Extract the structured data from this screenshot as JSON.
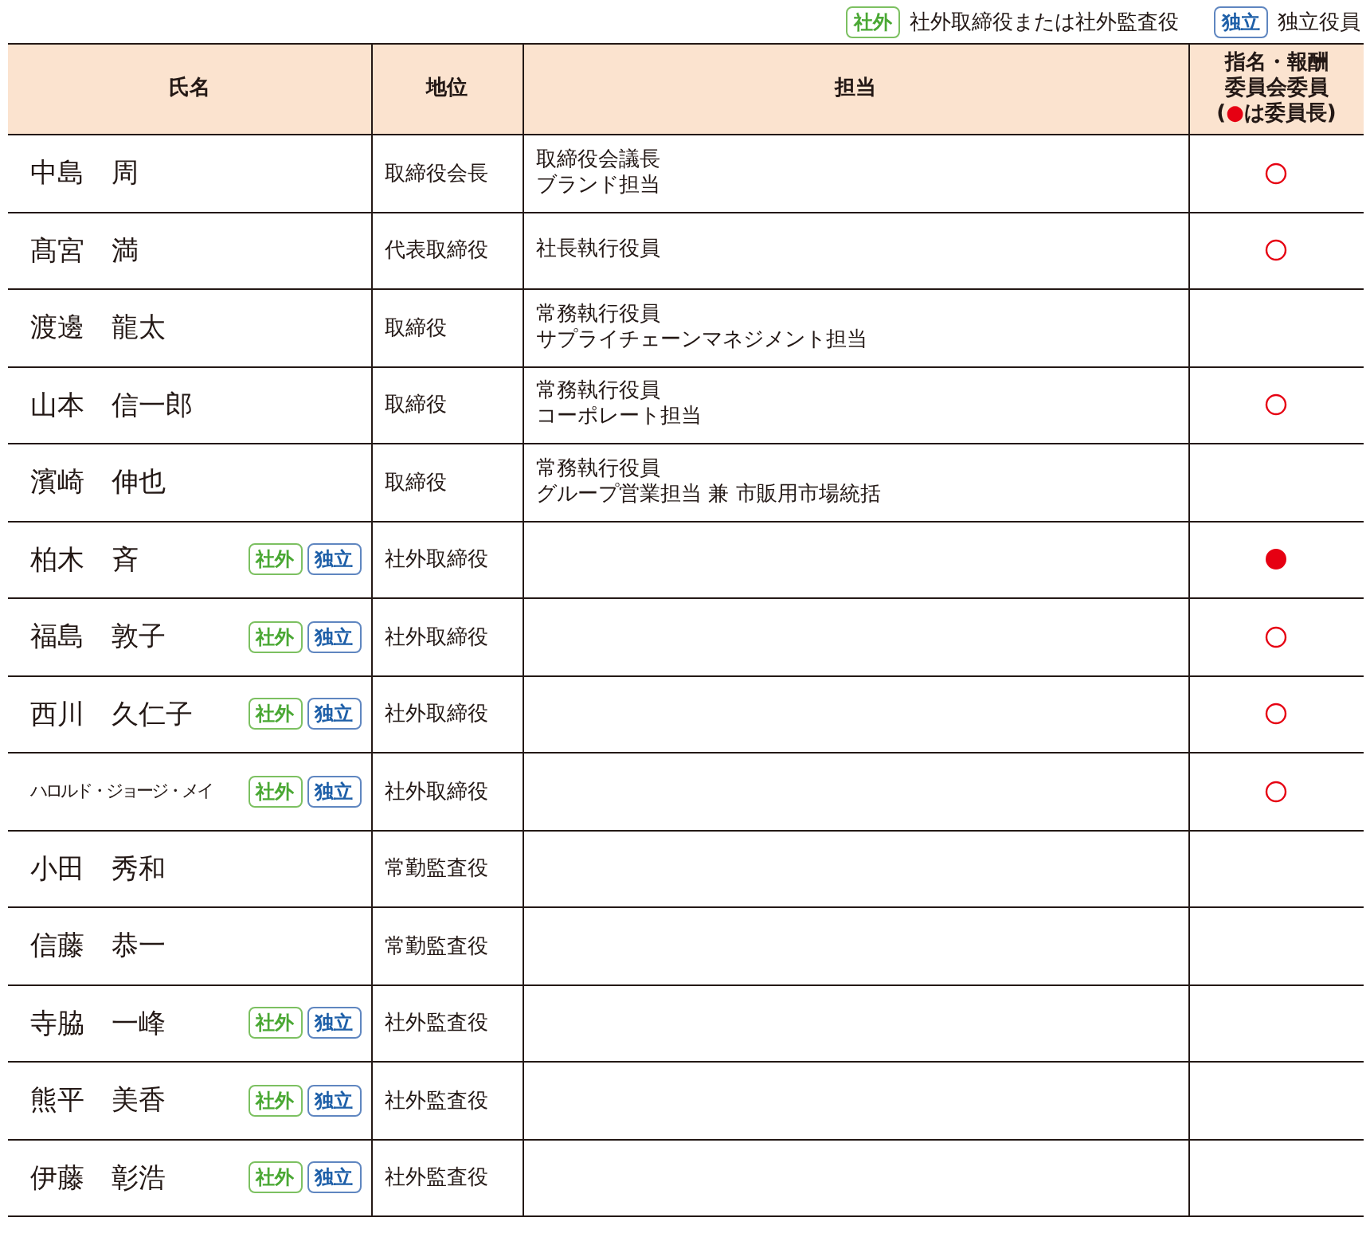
{
  "legend": [
    {
      "kind": "outside",
      "badge": "社外",
      "text": "社外取締役または社外監査役"
    },
    {
      "kind": "independent",
      "badge": "独立",
      "text": "独立役員"
    }
  ],
  "table": {
    "columns": [
      {
        "lines": [
          "氏名"
        ]
      },
      {
        "lines": [
          "地位"
        ]
      },
      {
        "lines": [
          "担当"
        ]
      },
      {
        "lines": [
          "指名・報酬",
          "委員会委員"
        ],
        "note_prefix": "(",
        "note_mark": "●",
        "note_suffix": "は委員長)"
      }
    ],
    "rows": [
      {
        "name": "中島　周",
        "tags": [],
        "position": "取締役会長",
        "duties": [
          "取締役会議長",
          "ブランド担当"
        ],
        "member": true,
        "chair": false
      },
      {
        "name": "髙宮　満",
        "tags": [],
        "position": "代表取締役",
        "duties": [
          "社長執行役員"
        ],
        "member": true,
        "chair": false
      },
      {
        "name": "渡邊　龍太",
        "tags": [],
        "position": "取締役",
        "duties": [
          "常務執行役員",
          "サプライチェーンマネジメント担当"
        ],
        "member": false,
        "chair": false
      },
      {
        "name": "山本　信一郎",
        "tags": [],
        "position": "取締役",
        "duties": [
          "常務執行役員",
          "コーポレート担当"
        ],
        "member": true,
        "chair": false
      },
      {
        "name": "濱崎　伸也",
        "tags": [],
        "position": "取締役",
        "duties": [
          "常務執行役員",
          "グループ営業担当 兼 市販用市場統括"
        ],
        "member": false,
        "chair": false
      },
      {
        "name": "柏木　斉",
        "tags": [
          {
            "kind": "outside",
            "label": "社外"
          },
          {
            "kind": "independent",
            "label": "独立"
          }
        ],
        "position": "社外取締役",
        "duties": [],
        "member": false,
        "chair": true
      },
      {
        "name": "福島　敦子",
        "tags": [
          {
            "kind": "outside",
            "label": "社外"
          },
          {
            "kind": "independent",
            "label": "独立"
          }
        ],
        "position": "社外取締役",
        "duties": [],
        "member": true,
        "chair": false
      },
      {
        "name": "西川　久仁子",
        "tags": [
          {
            "kind": "outside",
            "label": "社外"
          },
          {
            "kind": "independent",
            "label": "独立"
          }
        ],
        "position": "社外取締役",
        "duties": [],
        "member": true,
        "chair": false
      },
      {
        "name": "ハロルド・ジョージ・メイ",
        "small": true,
        "tags": [
          {
            "kind": "outside",
            "label": "社外"
          },
          {
            "kind": "independent",
            "label": "独立"
          }
        ],
        "position": "社外取締役",
        "duties": [],
        "member": true,
        "chair": false
      },
      {
        "name": "小田　秀和",
        "tags": [],
        "position": "常勤監査役",
        "duties": [],
        "member": false,
        "chair": false
      },
      {
        "name": "信藤　恭一",
        "tags": [],
        "position": "常勤監査役",
        "duties": [],
        "member": false,
        "chair": false
      },
      {
        "name": "寺脇　一峰",
        "tags": [
          {
            "kind": "outside",
            "label": "社外"
          },
          {
            "kind": "independent",
            "label": "独立"
          }
        ],
        "position": "社外監査役",
        "duties": [],
        "member": false,
        "chair": false
      },
      {
        "name": "熊平　美香",
        "tags": [
          {
            "kind": "outside",
            "label": "社外"
          },
          {
            "kind": "independent",
            "label": "独立"
          }
        ],
        "position": "社外監査役",
        "duties": [],
        "member": false,
        "chair": false
      },
      {
        "name": "伊藤　彰浩",
        "tags": [
          {
            "kind": "outside",
            "label": "社外"
          },
          {
            "kind": "independent",
            "label": "独立"
          }
        ],
        "position": "社外監査役",
        "duties": [],
        "member": false,
        "chair": false
      }
    ]
  }
}
